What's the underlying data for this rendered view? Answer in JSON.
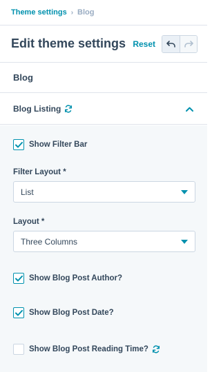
{
  "breadcrumb": {
    "parent": "Theme settings",
    "current": "Blog"
  },
  "header": {
    "title": "Edit theme settings",
    "reset_label": "Reset"
  },
  "section": {
    "title": "Blog"
  },
  "group": {
    "title": "Blog Listing",
    "expanded": true
  },
  "fields": {
    "show_filter_bar": {
      "label": "Show Filter Bar",
      "checked": true
    },
    "filter_layout": {
      "label": "Filter Layout *",
      "value": "List"
    },
    "layout": {
      "label": "Layout *",
      "value": "Three Columns"
    },
    "show_author": {
      "label": "Show Blog Post Author?",
      "checked": true
    },
    "show_date": {
      "label": "Show Blog Post Date?",
      "checked": true
    },
    "show_reading_time": {
      "label": "Show Blog Post Reading Time?",
      "checked": false
    }
  },
  "colors": {
    "accent": "#0091ae",
    "text": "#33475b",
    "panel_bg": "#f5f8fa",
    "border": "#cbd6e2"
  },
  "icons": {
    "undo": "undo-icon",
    "redo": "redo-icon",
    "sync": "sync-icon",
    "collapse": "chevron-up-icon",
    "dropdown": "caret-down-icon",
    "check": "check-icon"
  }
}
